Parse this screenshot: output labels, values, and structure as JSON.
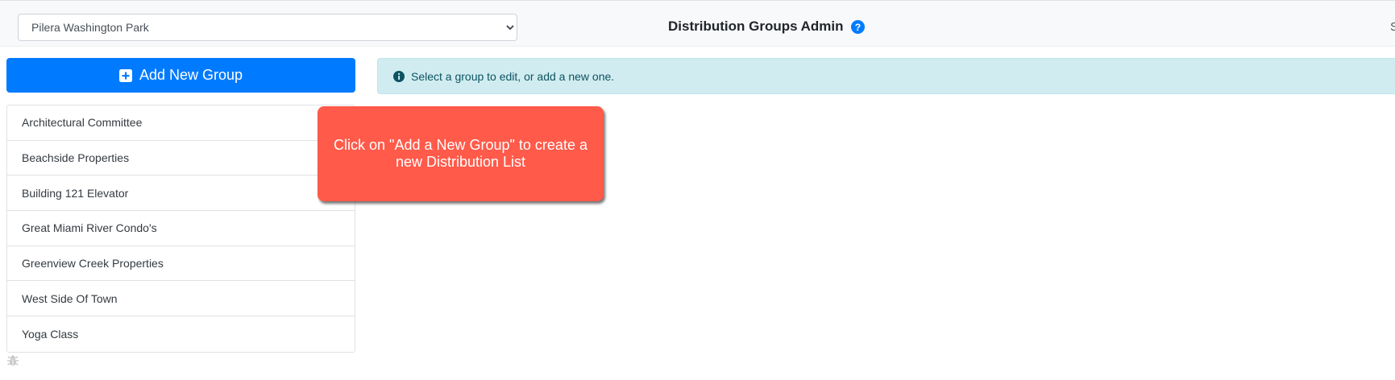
{
  "header": {
    "property_select": {
      "selected": "Pilera Washington Park",
      "options": [
        "Pilera Washington Park"
      ]
    },
    "title": "Distribution Groups Admin",
    "help_icon": "question-circle-icon",
    "edge_text": "S"
  },
  "sidebar": {
    "add_button_label": "Add New Group",
    "add_button_icon": "plus-square-icon",
    "groups": [
      {
        "label": "Architectural Committee"
      },
      {
        "label": "Beachside Properties"
      },
      {
        "label": "Building 121 Elevator"
      },
      {
        "label": "Great Miami River Condo's"
      },
      {
        "label": "Greenview Creek Properties"
      },
      {
        "label": "West Side Of Town"
      },
      {
        "label": "Yoga Class"
      }
    ],
    "footer_icon": "bug-icon"
  },
  "main": {
    "info_message": "Select a group to edit, or add a new one.",
    "info_icon": "info-circle-icon"
  },
  "tooltip": {
    "text": "Click on \"Add a New Group\" to create a new Distribution List"
  },
  "colors": {
    "primary": "#007bff",
    "info_bg": "#d1ecf1",
    "info_text": "#0c5460",
    "tooltip_bg": "#ff5a4a"
  }
}
